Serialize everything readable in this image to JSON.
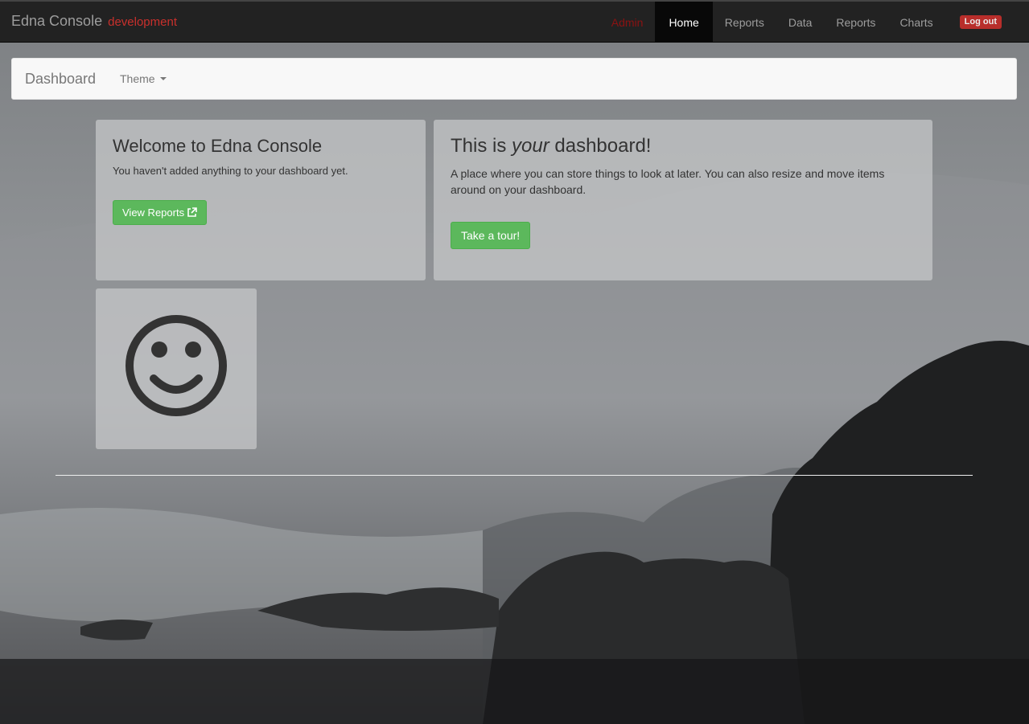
{
  "navbar": {
    "brand": "Edna Console",
    "environment": "development",
    "links": [
      {
        "label": "Admin"
      },
      {
        "label": "Home",
        "active": true
      },
      {
        "label": "Reports"
      },
      {
        "label": "Data"
      },
      {
        "label": "Reports"
      },
      {
        "label": "Charts"
      }
    ],
    "logout_label": "Log out"
  },
  "subnav": {
    "title": "Dashboard",
    "theme_label": "Theme"
  },
  "welcome_panel": {
    "heading": "Welcome to Edna Console",
    "text": "You haven't added anything to your dashboard yet.",
    "button_label": "View Reports"
  },
  "dashboard_panel": {
    "heading_pre": "This is ",
    "heading_em": "your",
    "heading_post": " dashboard!",
    "text": "A place where you can store things to look at later. You can also resize and move items around on your dashboard.",
    "button_label": "Take a tour!"
  },
  "smiley_panel": {
    "icon": "smiley-icon"
  },
  "colors": {
    "navbar_bg": "#222222",
    "environment": "#c9302c",
    "admin_link": "#8b1212",
    "button_green": "#5cb85c",
    "logout_badge": "#c9302c"
  }
}
